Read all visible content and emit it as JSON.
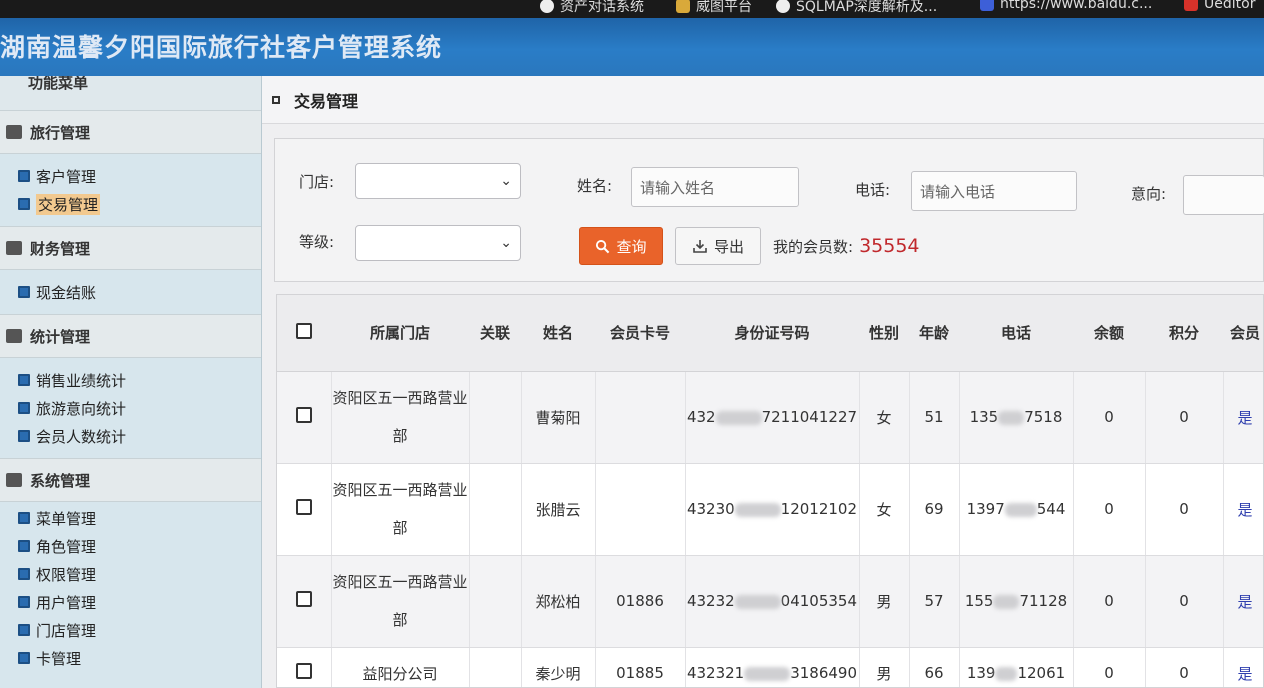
{
  "bookmarks": [
    {
      "label": "资产对话系统"
    },
    {
      "label": "威图平台"
    },
    {
      "label": "SQLMAP深度解析及..."
    },
    {
      "label": "https://www.baidu.c..."
    },
    {
      "label": "Ueditor"
    }
  ],
  "app": {
    "title": "湖南温馨夕阳国际旅行社客户管理系统"
  },
  "sidebar": {
    "header": "功能菜单",
    "sections": [
      {
        "title": "旅行管理",
        "items": [
          "客户管理",
          "交易管理"
        ]
      },
      {
        "title": "财务管理",
        "items": [
          "现金结账"
        ]
      },
      {
        "title": "统计管理",
        "items": [
          "销售业绩统计",
          "旅游意向统计",
          "会员人数统计"
        ]
      },
      {
        "title": "系统管理",
        "items": [
          "菜单管理",
          "角色管理",
          "权限管理",
          "用户管理",
          "门店管理",
          "卡管理"
        ]
      }
    ],
    "active_item": "交易管理"
  },
  "page": {
    "title": "交易管理"
  },
  "filters": {
    "store_label": "门店:",
    "name_label": "姓名:",
    "name_placeholder": "请输入姓名",
    "phone_label": "电话:",
    "phone_placeholder": "请输入电话",
    "intent_label": "意向:",
    "level_label": "等级:",
    "query_button": "查询",
    "export_button": "导出",
    "member_count_label": "我的会员数:",
    "member_count": "35554"
  },
  "table": {
    "columns": [
      "所属门店",
      "关联",
      "姓名",
      "会员卡号",
      "身份证号码",
      "性别",
      "年龄",
      "电话",
      "余额",
      "积分",
      "会员"
    ],
    "rows": [
      {
        "store": "资阳区五一西路营业部",
        "link": "",
        "name": "曹菊阳",
        "card": "",
        "id_prefix": "432",
        "id_suffix": "7211041227",
        "gender": "女",
        "age": "51",
        "phone_prefix": "135",
        "phone_suffix": "7518",
        "balance": "0",
        "points": "0",
        "member": "是"
      },
      {
        "store": "资阳区五一西路营业部",
        "link": "",
        "name": "张腊云",
        "card": "",
        "id_prefix": "43230",
        "id_suffix": "12012102",
        "gender": "女",
        "age": "69",
        "phone_prefix": "1397",
        "phone_suffix": "544",
        "balance": "0",
        "points": "0",
        "member": "是"
      },
      {
        "store": "资阳区五一西路营业部",
        "link": "",
        "name": "郑松柏",
        "card": "01886",
        "id_prefix": "43232",
        "id_suffix": "04105354",
        "gender": "男",
        "age": "57",
        "phone_prefix": "155",
        "phone_suffix": "71128",
        "balance": "0",
        "points": "0",
        "member": "是"
      },
      {
        "store": "益阳分公司",
        "link": "",
        "name": "秦少明",
        "card": "01885",
        "id_prefix": "432321",
        "id_suffix": "3186490",
        "gender": "男",
        "age": "66",
        "phone_prefix": "139",
        "phone_suffix": "12061",
        "balance": "0",
        "points": "0",
        "member": "是"
      }
    ]
  }
}
